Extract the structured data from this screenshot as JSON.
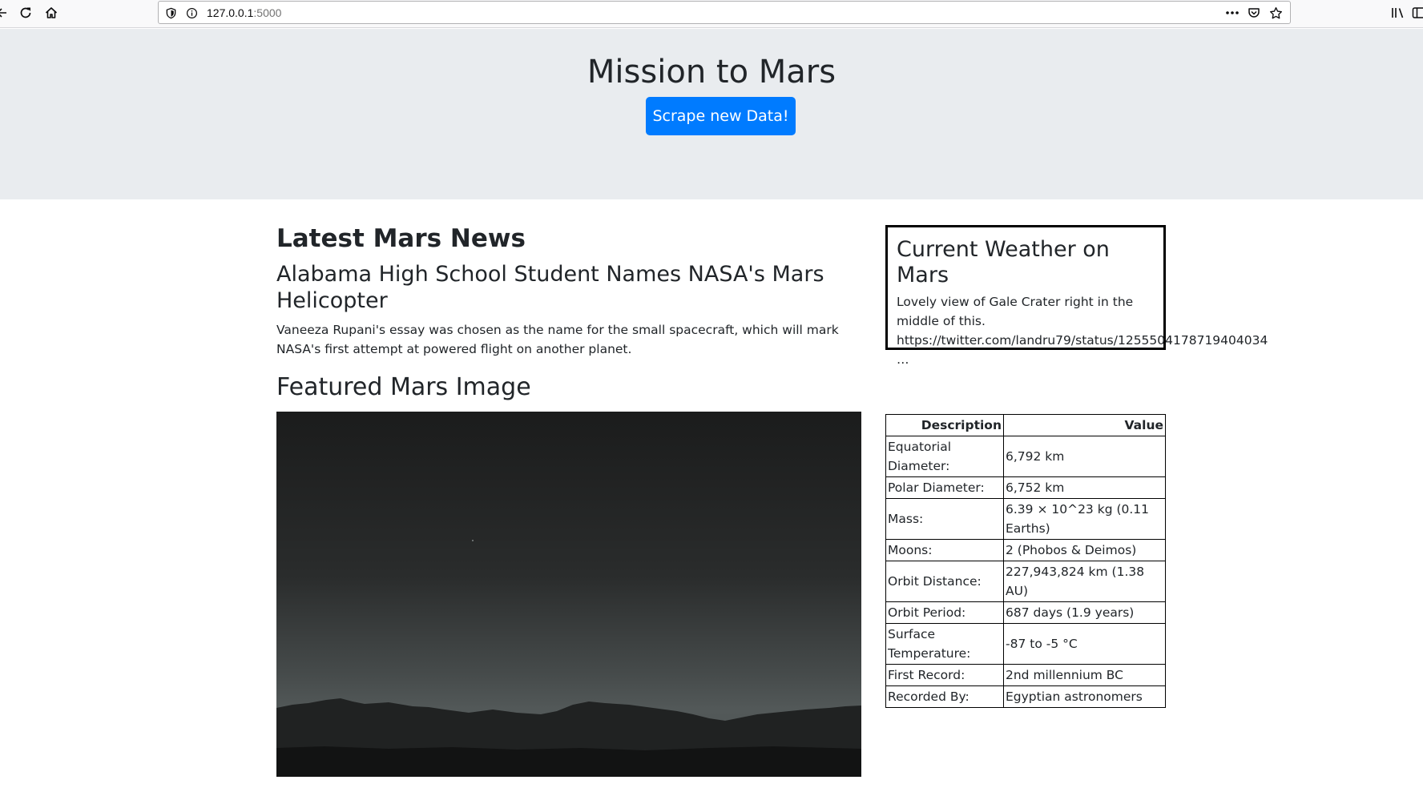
{
  "browser": {
    "url_host": "127.0.0.1",
    "url_port": ":5000",
    "icons": [
      "back-arrow-icon",
      "reload-icon",
      "home-icon",
      "shield-icon",
      "info-icon",
      "more-icon",
      "pocket-icon",
      "bookmark-star-icon",
      "library-icon",
      "sidebar-icon"
    ]
  },
  "jumbotron": {
    "title": "Mission to Mars",
    "button_label": "Scrape new Data!"
  },
  "news": {
    "heading": "Latest Mars News",
    "title": "Alabama High School Student Names NASA's Mars Helicopter",
    "teaser": "Vaneeza Rupani's essay was chosen as the name for the small spacecraft, which will mark NASA's first attempt at powered flight on another planet."
  },
  "featured": {
    "heading": "Featured Mars Image"
  },
  "weather": {
    "title": "Current Weather on Mars",
    "text": "Lovely view of Gale Crater right in the middle of this. https://twitter.com/landru79/status/1255504178719404034 …"
  },
  "facts": {
    "headers": [
      "Description",
      "Value"
    ],
    "rows": [
      {
        "description": "Equatorial Diameter:",
        "value": "6,792 km"
      },
      {
        "description": "Polar Diameter:",
        "value": "6,752 km"
      },
      {
        "description": "Mass:",
        "value": "6.39 × 10^23 kg (0.11 Earths)"
      },
      {
        "description": "Moons:",
        "value": "2 (Phobos & Deimos)"
      },
      {
        "description": "Orbit Distance:",
        "value": "227,943,824 km (1.38 AU)"
      },
      {
        "description": "Orbit Period:",
        "value": "687 days (1.9 years)"
      },
      {
        "description": "Surface Temperature:",
        "value": "-87 to -5 °C"
      },
      {
        "description": "First Record:",
        "value": "2nd millennium BC"
      },
      {
        "description": "Recorded By:",
        "value": "Egyptian astronomers"
      }
    ]
  }
}
